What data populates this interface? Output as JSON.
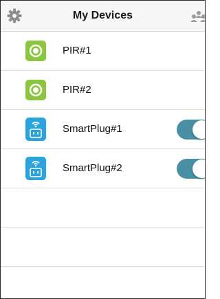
{
  "header": {
    "title": "My Devices",
    "left_icon": "gear-icon",
    "right_icon": "group-icon"
  },
  "devices": [
    {
      "label": "PIR#1",
      "icon": "pir-sensor-icon"
    },
    {
      "label": "PIR#2",
      "icon": "pir-sensor-icon"
    },
    {
      "label": "SmartPlug#1",
      "icon": "smart-plug-icon",
      "toggle_on": true
    },
    {
      "label": "SmartPlug#2",
      "icon": "smart-plug-icon",
      "toggle_on": true
    }
  ],
  "colors": {
    "pir_green": "#8cc63f",
    "plug_blue": "#2aa3df",
    "toggle_on": "#4a90a4",
    "icon_gray": "#8f8f8f"
  }
}
